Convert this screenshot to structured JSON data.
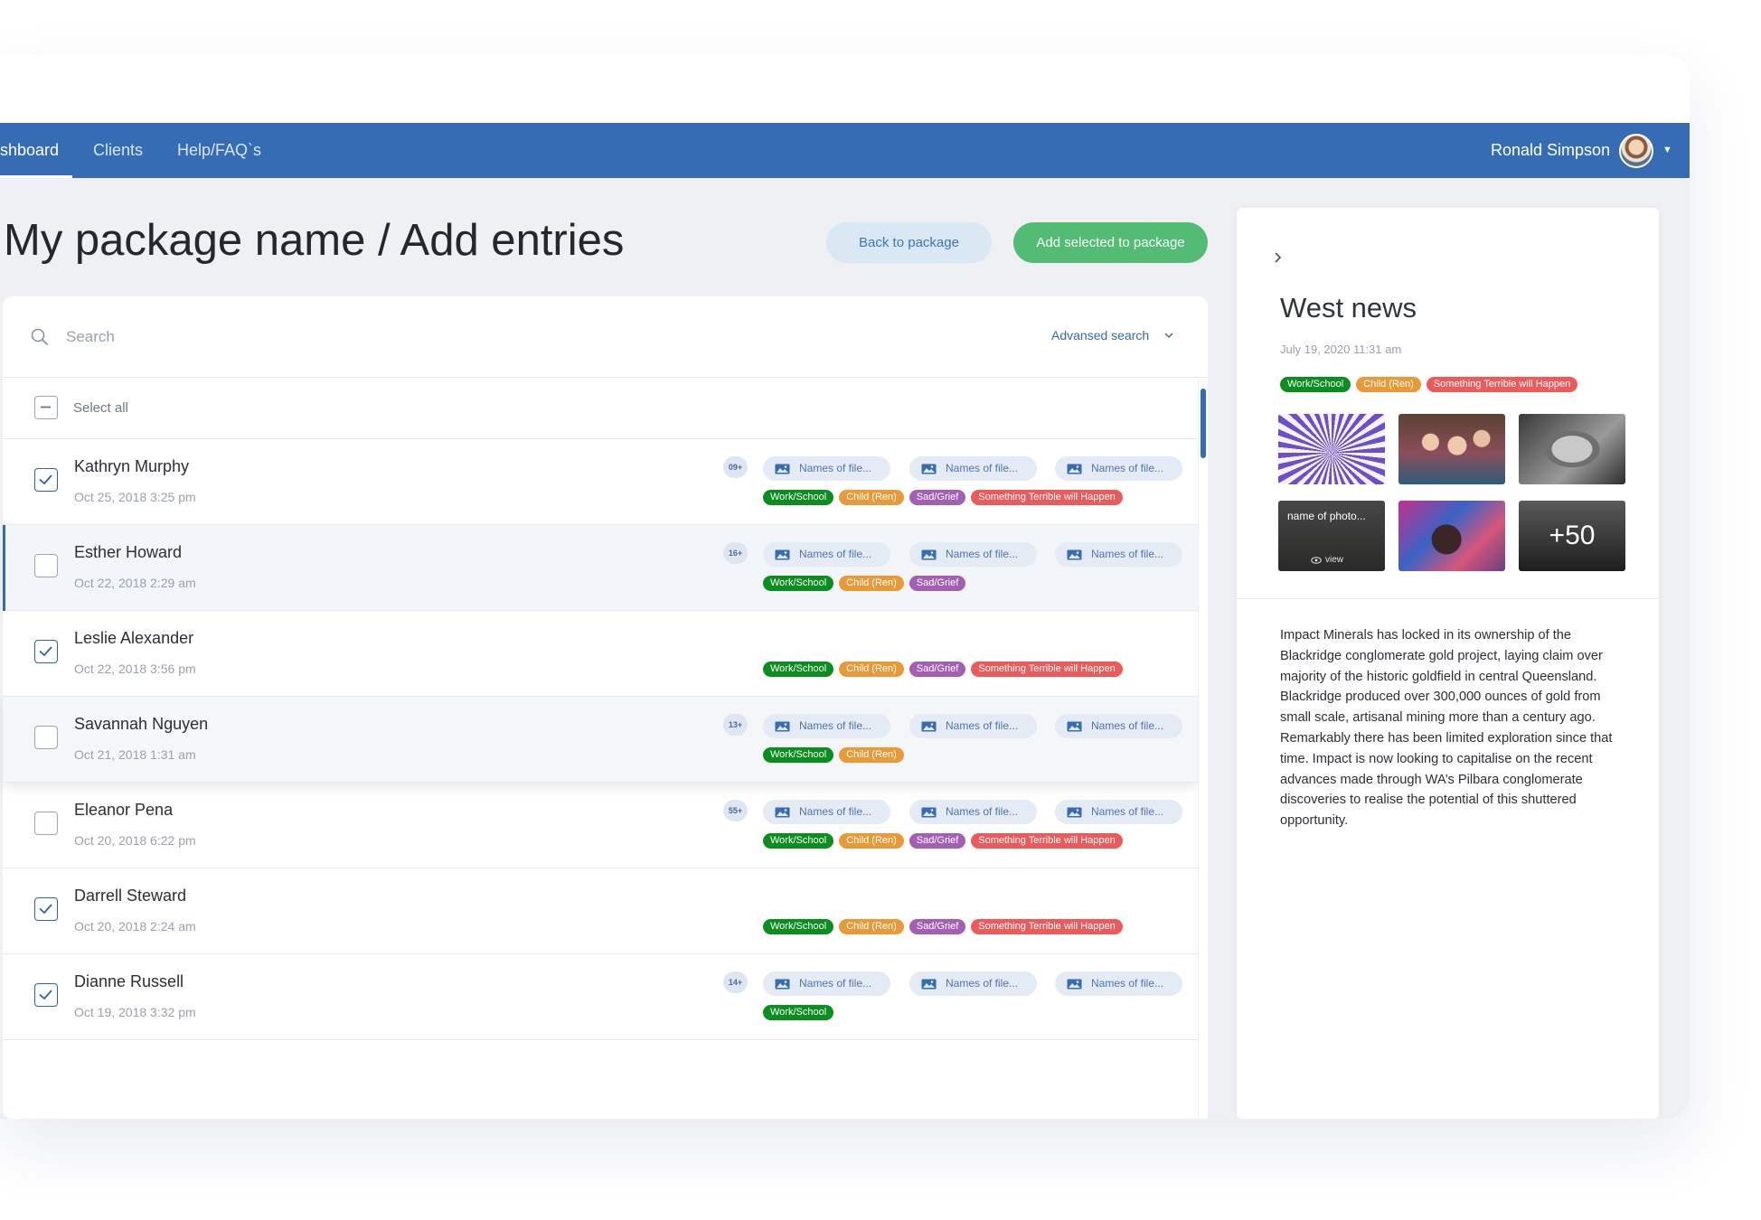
{
  "nav": {
    "items": [
      "shboard",
      "Clients",
      "Help/FAQ`s"
    ],
    "user_name": "Ronald Simpson"
  },
  "page": {
    "title": "My package name / Add entries",
    "back_button": "Back to package",
    "add_button": "Add selected to package"
  },
  "search": {
    "placeholder": "Search",
    "advanced_label": "Advansed search"
  },
  "select_all_label": "Select all",
  "entries": [
    {
      "name": "Kathryn Murphy",
      "date": "Oct 25, 2018 3:25 pm",
      "checked": true,
      "count": "09+",
      "files": [
        "Names of file...",
        "Names of file...",
        "Names of file..."
      ],
      "tags": [
        "Work/School",
        "Child (Ren)",
        "Sad/Grief",
        "Something Terrible will Happen"
      ]
    },
    {
      "name": "Esther Howard",
      "date": "Oct 22, 2018 2:29 am",
      "checked": false,
      "count": "16+",
      "files": [
        "Names of file...",
        "Names of file...",
        "Names of file..."
      ],
      "tags": [
        "Work/School",
        "Child (Ren)",
        "Sad/Grief"
      ]
    },
    {
      "name": "Leslie Alexander",
      "date": "Oct 22, 2018 3:56 pm",
      "checked": true,
      "count": "",
      "files": [],
      "tags": [
        "Work/School",
        "Child (Ren)",
        "Sad/Grief",
        "Something Terrible will Happen"
      ]
    },
    {
      "name": "Savannah Nguyen",
      "date": "Oct 21, 2018 1:31 am",
      "checked": false,
      "count": "13+",
      "files": [
        "Names of file...",
        "Names of file...",
        "Names of file..."
      ],
      "tags": [
        "Work/School",
        "Child (Ren)"
      ]
    },
    {
      "name": "Eleanor Pena",
      "date": "Oct 20, 2018 6:22 pm",
      "checked": false,
      "count": "55+",
      "files": [
        "Names of file...",
        "Names of file...",
        "Names of file..."
      ],
      "tags": [
        "Work/School",
        "Child (Ren)",
        "Sad/Grief",
        "Something Terrible will Happen"
      ]
    },
    {
      "name": "Darrell Steward",
      "date": "Oct 20, 2018 2:24 am",
      "checked": true,
      "count": "",
      "files": [],
      "tags": [
        "Work/School",
        "Child (Ren)",
        "Sad/Grief",
        "Something Terrible will Happen"
      ]
    },
    {
      "name": "Dianne Russell",
      "date": "Oct 19, 2018 3:32 pm",
      "checked": true,
      "count": "14+",
      "files": [
        "Names of file...",
        "Names of file...",
        "Names of file..."
      ],
      "tags": [
        "Work/School"
      ]
    }
  ],
  "detail": {
    "title": "West news",
    "date": "July 19, 2020 11:31 am",
    "tags": [
      "Work/School",
      "Child (Ren)",
      "Something Terrible will Happen"
    ],
    "photo_caption": "name of photo...",
    "photo_view_label": "view",
    "more_photos": "+50",
    "body": "Impact Minerals has locked in its ownership of the Blackridge conglomerate gold project, laying claim over majority of the historic goldfield in central Queensland. Blackridge produced over 300,000 ounces of gold from small scale, artisanal mining more than a century ago. Remarkably there has been limited exploration since that time. Impact is now looking to capitalise on the recent advances made through WA’s Pilbara conglomerate discoveries to realise the potential of this shuttered opportunity."
  },
  "tag_colors": {
    "Work/School": "#0c8d1f",
    "Child (Ren)": "#e99a38",
    "Sad/Grief": "#a35fb3",
    "Something Terrible will Happen": "#ec5b5b"
  },
  "colors": {
    "nav_bg": "#356cb3",
    "primary_green": "#52bb74",
    "secondary_button_bg": "#d9e8f3"
  }
}
